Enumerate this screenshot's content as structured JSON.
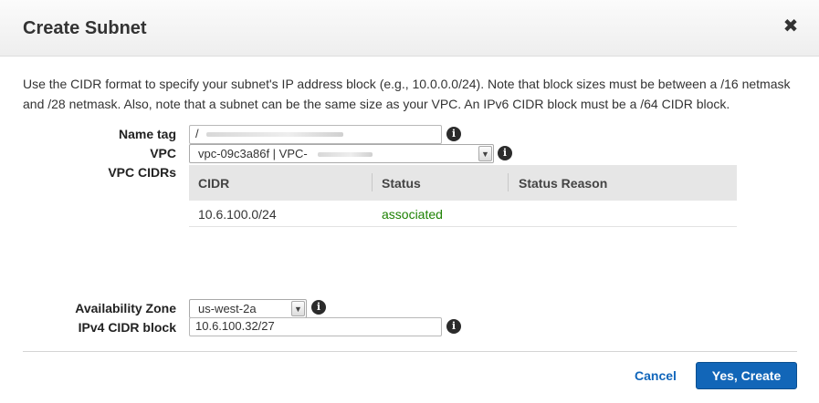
{
  "dialog": {
    "title": "Create Subnet",
    "close_glyph": "✖",
    "description": "Use the CIDR format to specify your subnet's IP address block (e.g., 10.0.0.0/24). Note that block sizes must be between a /16 netmask and /28 netmask. Also, note that a subnet can be the same size as your VPC. An IPv6 CIDR block must be a /64 CIDR block."
  },
  "form": {
    "name_tag": {
      "label": "Name tag",
      "value": "/"
    },
    "vpc": {
      "label": "VPC",
      "value": "vpc-09c3a86f | VPC-"
    },
    "vpc_cidrs": {
      "label": "VPC CIDRs",
      "columns": [
        "CIDR",
        "Status",
        "Status Reason"
      ],
      "rows": [
        {
          "cidr": "10.6.100.0/24",
          "status": "associated",
          "reason": ""
        }
      ]
    },
    "availability_zone": {
      "label": "Availability Zone",
      "value": "us-west-2a"
    },
    "ipv4_cidr_block": {
      "label": "IPv4 CIDR block",
      "value": "10.6.100.32/27"
    }
  },
  "footer": {
    "cancel_label": "Cancel",
    "create_label": "Yes, Create"
  },
  "icons": {
    "info": "i",
    "dropdown": "▼"
  },
  "colors": {
    "status_ok": "#1d8102",
    "primary": "#1266b8",
    "link": "#1166bb"
  }
}
